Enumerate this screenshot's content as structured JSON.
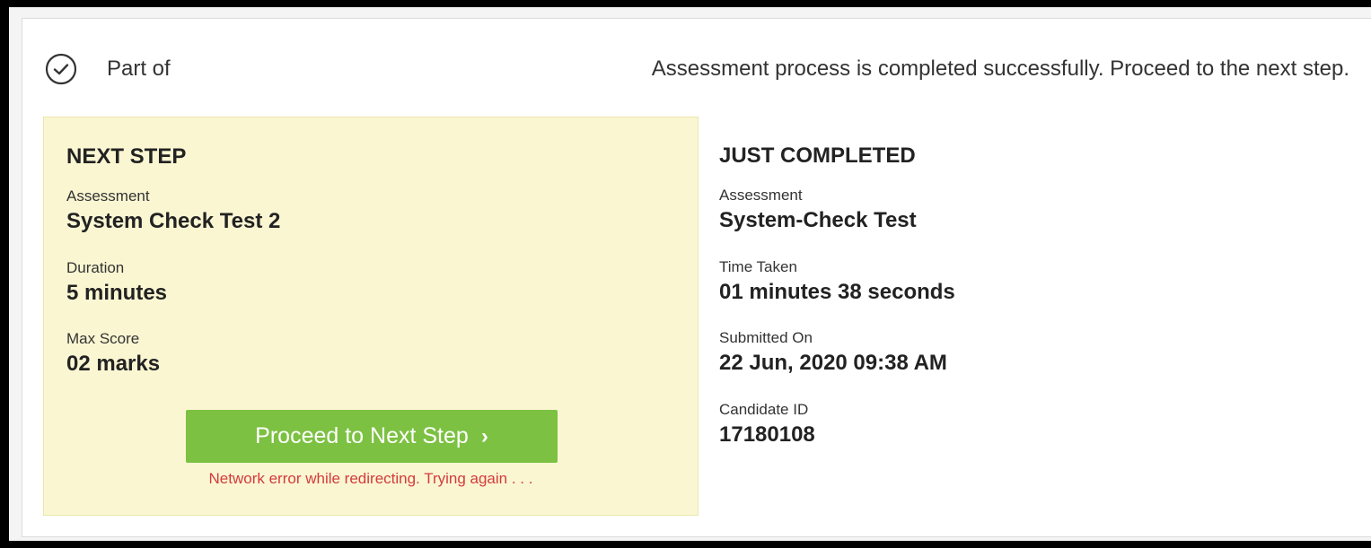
{
  "header": {
    "part_of": "Part of",
    "message": "Assessment process is completed successfully. Proceed to the next step."
  },
  "next_step": {
    "heading": "NEXT STEP",
    "assessment_label": "Assessment",
    "assessment_value": "System Check Test 2",
    "duration_label": "Duration",
    "duration_value": "5 minutes",
    "max_score_label": "Max Score",
    "max_score_value": "02 marks",
    "proceed_label": "Proceed to Next Step",
    "proceed_chevron": "›",
    "error_message": "Network error while redirecting. Trying again . . ."
  },
  "just_completed": {
    "heading": "JUST COMPLETED",
    "assessment_label": "Assessment",
    "assessment_value": "System-Check Test",
    "time_taken_label": "Time Taken",
    "time_taken_value": "01 minutes 38 seconds",
    "submitted_on_label": "Submitted On",
    "submitted_on_value": "22 Jun, 2020 09:38 AM",
    "candidate_id_label": "Candidate ID",
    "candidate_id_value": "17180108"
  },
  "colors": {
    "accent_green": "#7cc142",
    "next_panel_bg": "#faf6d2",
    "error_red": "#d43b3b"
  },
  "icons": {
    "status": "check-circle-icon",
    "proceed": "chevron-right-icon"
  }
}
